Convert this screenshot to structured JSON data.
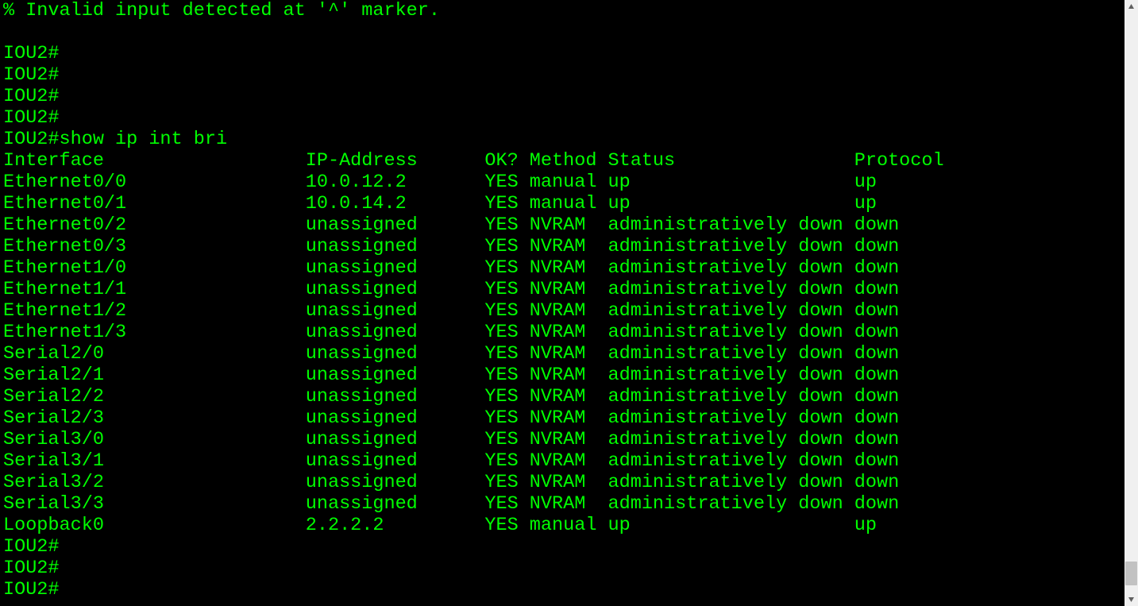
{
  "colors": {
    "fg": "#00ff00",
    "bg": "#000000"
  },
  "error_line": "% Invalid input detected at '^' marker.",
  "blank_line": "",
  "prompt": "IOU2#",
  "command_line": "IOU2#show ip int bri",
  "headers": {
    "interface": "Interface",
    "ip": "IP-Address",
    "ok": "OK?",
    "method": "Method",
    "status": "Status",
    "protocol": "Protocol"
  },
  "rows": [
    {
      "interface": "Ethernet0/0",
      "ip": "10.0.12.2",
      "ok": "YES",
      "method": "manual",
      "status": "up",
      "protocol": "up"
    },
    {
      "interface": "Ethernet0/1",
      "ip": "10.0.14.2",
      "ok": "YES",
      "method": "manual",
      "status": "up",
      "protocol": "up"
    },
    {
      "interface": "Ethernet0/2",
      "ip": "unassigned",
      "ok": "YES",
      "method": "NVRAM",
      "status": "administratively down",
      "protocol": "down"
    },
    {
      "interface": "Ethernet0/3",
      "ip": "unassigned",
      "ok": "YES",
      "method": "NVRAM",
      "status": "administratively down",
      "protocol": "down"
    },
    {
      "interface": "Ethernet1/0",
      "ip": "unassigned",
      "ok": "YES",
      "method": "NVRAM",
      "status": "administratively down",
      "protocol": "down"
    },
    {
      "interface": "Ethernet1/1",
      "ip": "unassigned",
      "ok": "YES",
      "method": "NVRAM",
      "status": "administratively down",
      "protocol": "down"
    },
    {
      "interface": "Ethernet1/2",
      "ip": "unassigned",
      "ok": "YES",
      "method": "NVRAM",
      "status": "administratively down",
      "protocol": "down"
    },
    {
      "interface": "Ethernet1/3",
      "ip": "unassigned",
      "ok": "YES",
      "method": "NVRAM",
      "status": "administratively down",
      "protocol": "down"
    },
    {
      "interface": "Serial2/0",
      "ip": "unassigned",
      "ok": "YES",
      "method": "NVRAM",
      "status": "administratively down",
      "protocol": "down"
    },
    {
      "interface": "Serial2/1",
      "ip": "unassigned",
      "ok": "YES",
      "method": "NVRAM",
      "status": "administratively down",
      "protocol": "down"
    },
    {
      "interface": "Serial2/2",
      "ip": "unassigned",
      "ok": "YES",
      "method": "NVRAM",
      "status": "administratively down",
      "protocol": "down"
    },
    {
      "interface": "Serial2/3",
      "ip": "unassigned",
      "ok": "YES",
      "method": "NVRAM",
      "status": "administratively down",
      "protocol": "down"
    },
    {
      "interface": "Serial3/0",
      "ip": "unassigned",
      "ok": "YES",
      "method": "NVRAM",
      "status": "administratively down",
      "protocol": "down"
    },
    {
      "interface": "Serial3/1",
      "ip": "unassigned",
      "ok": "YES",
      "method": "NVRAM",
      "status": "administratively down",
      "protocol": "down"
    },
    {
      "interface": "Serial3/2",
      "ip": "unassigned",
      "ok": "YES",
      "method": "NVRAM",
      "status": "administratively down",
      "protocol": "down"
    },
    {
      "interface": "Serial3/3",
      "ip": "unassigned",
      "ok": "YES",
      "method": "NVRAM",
      "status": "administratively down",
      "protocol": "down"
    },
    {
      "interface": "Loopback0",
      "ip": "2.2.2.2",
      "ok": "YES",
      "method": "manual",
      "status": "up",
      "protocol": "up"
    }
  ],
  "trailing_prompts": [
    "IOU2#",
    "IOU2#",
    "IOU2#"
  ],
  "col_widths": {
    "interface": 27,
    "ip": 16,
    "ok": 4,
    "method": 7,
    "status": 22
  }
}
